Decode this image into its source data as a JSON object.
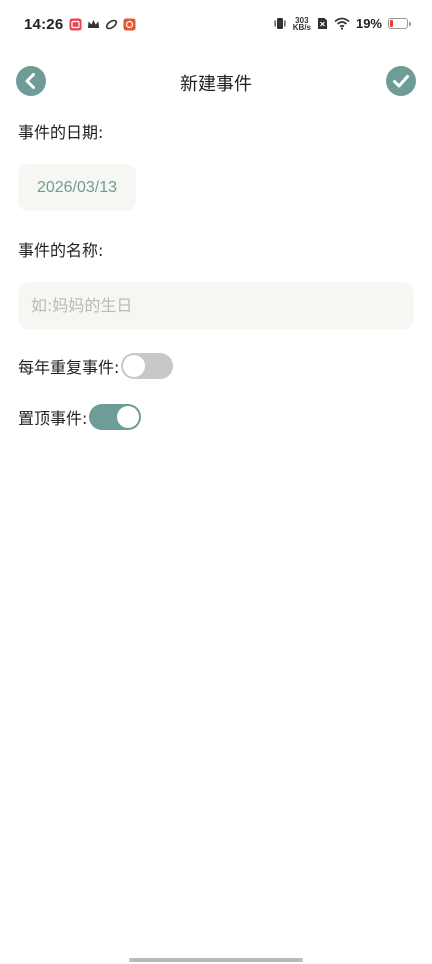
{
  "status_bar": {
    "time": "14:26",
    "net_speed_value": "303",
    "net_speed_unit": "KB/s",
    "battery_percent": "19%",
    "battery_level": 0.19,
    "battery_color": "#e8413b"
  },
  "header": {
    "title": "新建事件",
    "accent_color": "#6e9c96"
  },
  "form": {
    "date_label": "事件的日期:",
    "date_value": "2026/03/13",
    "name_label": "事件的名称:",
    "name_value": "",
    "name_placeholder": "如:妈妈的生日",
    "repeat_label": "每年重复事件:",
    "repeat_on": false,
    "pin_label": "置顶事件:",
    "pin_on": true
  }
}
